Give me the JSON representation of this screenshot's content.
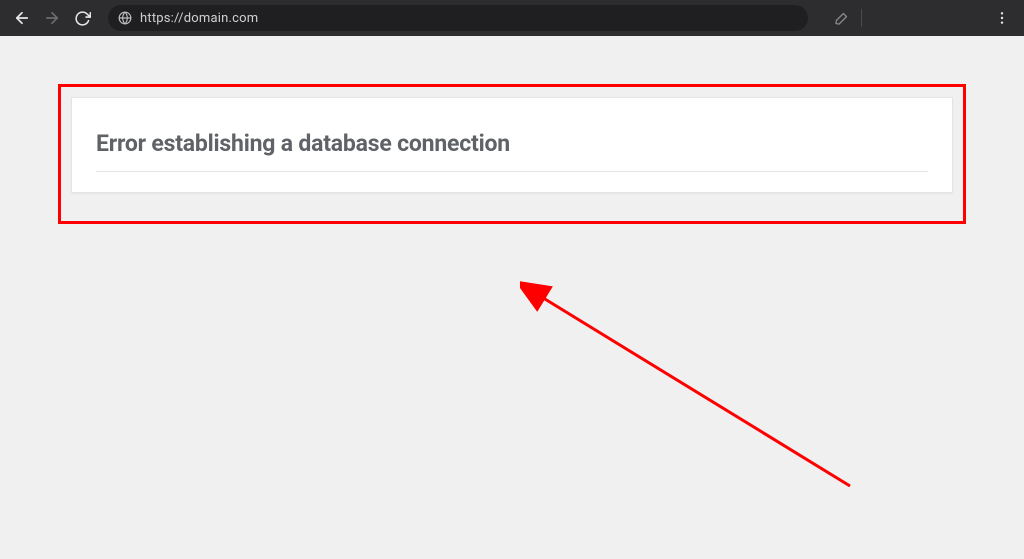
{
  "browser": {
    "url": "https://domain.com"
  },
  "page": {
    "error_heading": "Error establishing a database connection"
  }
}
